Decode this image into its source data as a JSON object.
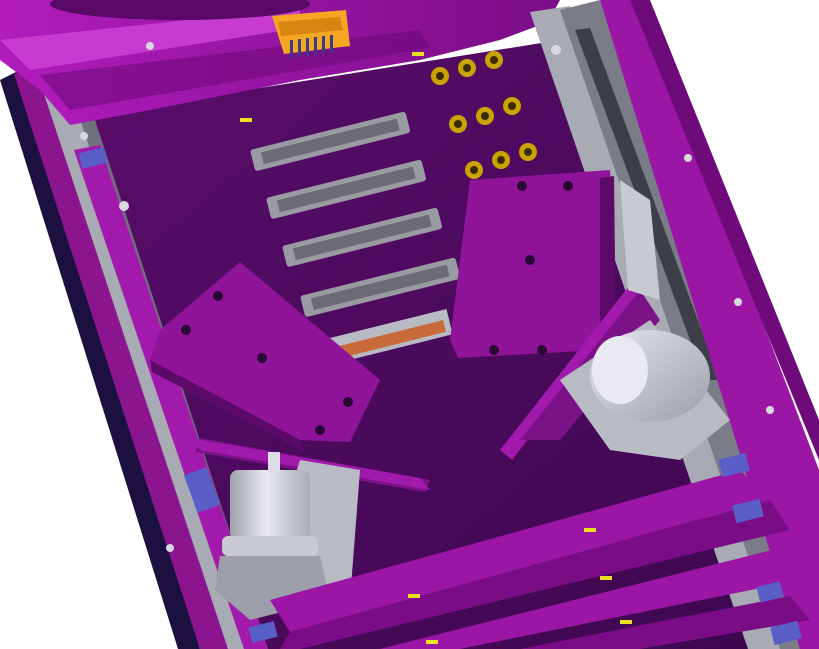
{
  "scene": {
    "subject": "cad-assembly-render",
    "palette": {
      "background": "#ffffff",
      "panel_purple": "#9c16a6",
      "panel_deep": "#6e0a7a",
      "plate_dark": "#4c0a5c",
      "rib_light": "#c73bd0",
      "frame_gray": "#a8aab4",
      "frame_dark": "#6f717c",
      "connector_gray": "#9a9aa2",
      "bracket_gray": "#c8cad2",
      "motor_white": "#dcdde6",
      "slot_blue": "#5a5fc8",
      "gold": "#c9a400",
      "orange_connector": "#f5a623",
      "copper": "#c86a3a",
      "yellow_mark": "#e8e020"
    }
  }
}
